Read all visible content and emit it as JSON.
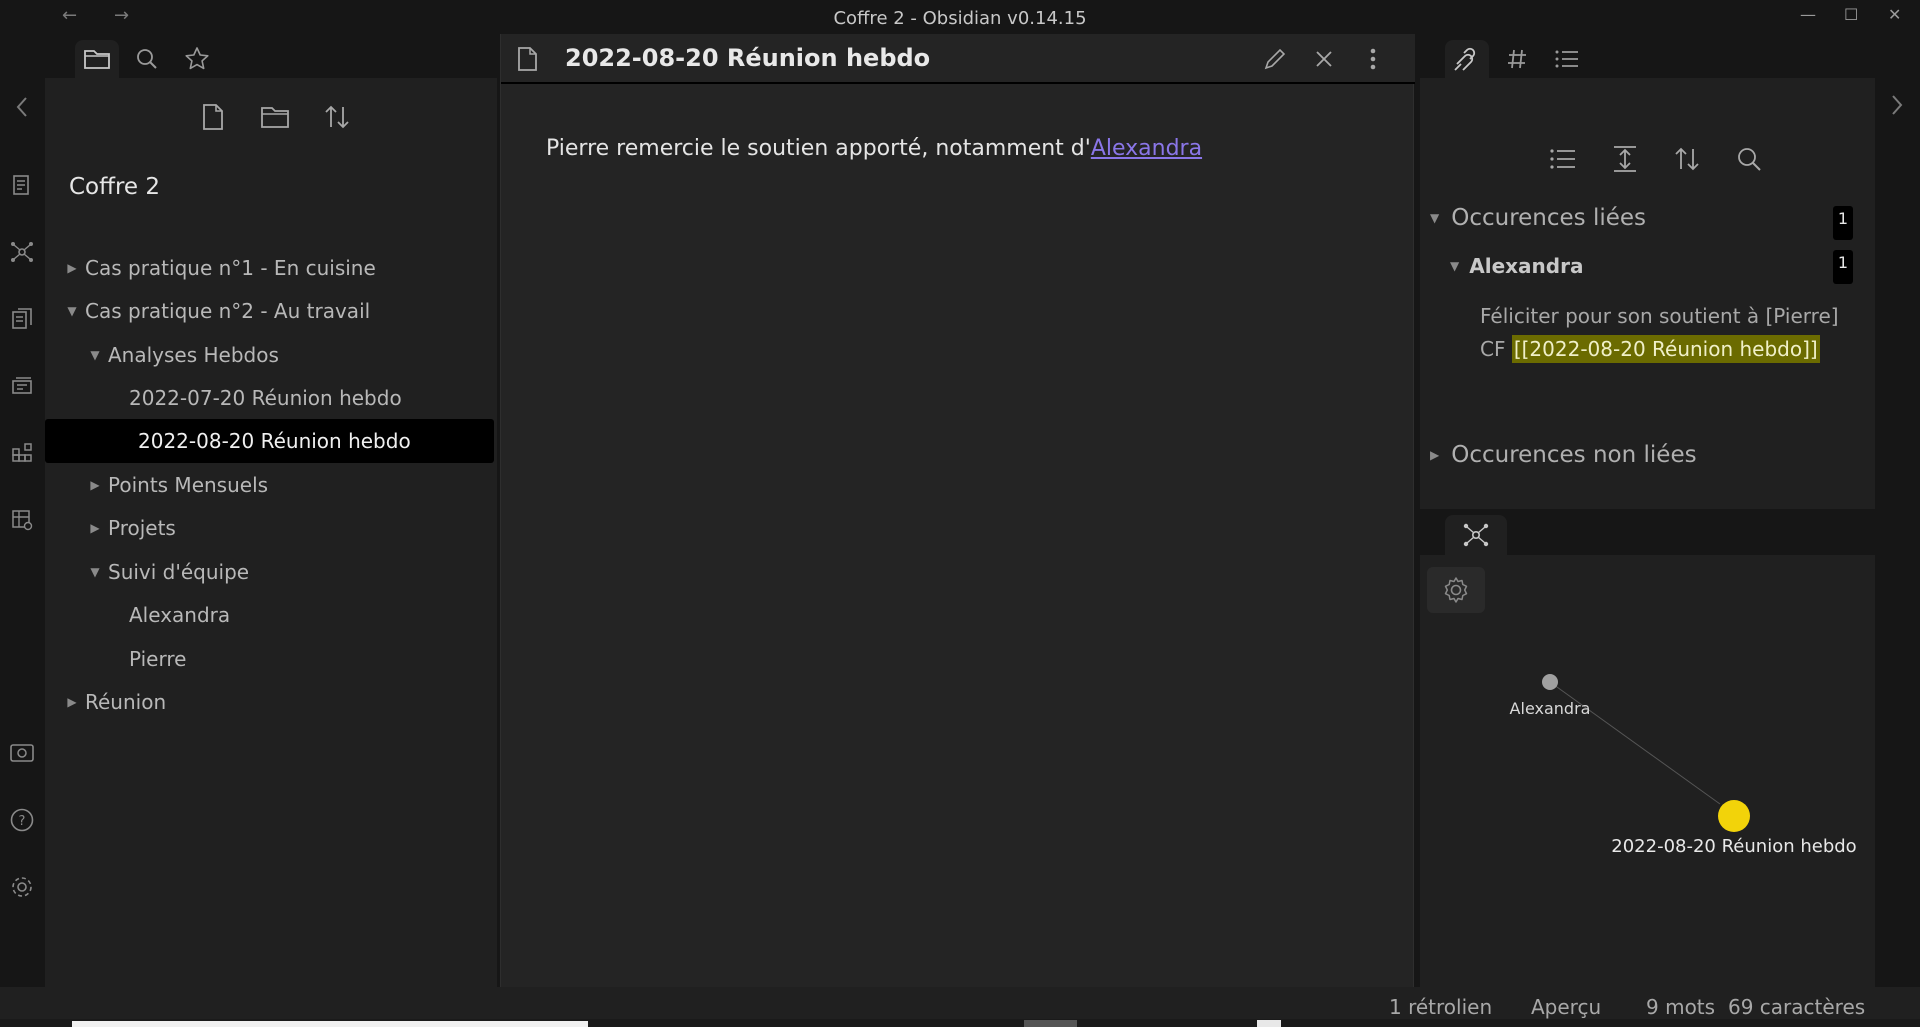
{
  "window": {
    "title": "Coffre 2 - Obsidian v0.14.15",
    "back": "←",
    "forward": "→",
    "minimize": "—",
    "maximize": "☐",
    "close": "✕"
  },
  "explorer": {
    "vault_name": "Coffre 2",
    "tree": [
      {
        "label": "Cas pratique n°1 - En cuisine",
        "caret": "▶"
      },
      {
        "label": "Cas pratique n°2 - Au travail",
        "caret": "▼"
      },
      {
        "label": "Analyses Hebdos",
        "caret": "▼"
      },
      {
        "label": "2022-07-20 Réunion hebdo",
        "caret": ""
      },
      {
        "label": "2022-08-20 Réunion hebdo",
        "caret": ""
      },
      {
        "label": "Points Mensuels",
        "caret": "▶"
      },
      {
        "label": "Projets",
        "caret": "▶"
      },
      {
        "label": "Suivi d'équipe",
        "caret": "▼"
      },
      {
        "label": "Alexandra",
        "caret": ""
      },
      {
        "label": "Pierre",
        "caret": ""
      },
      {
        "label": "Réunion",
        "caret": "▶"
      }
    ]
  },
  "editor": {
    "title": "2022-08-20 Réunion hebdo",
    "text_before": "Pierre remercie le soutien apporté, notamment d'",
    "link_text": "Alexandra"
  },
  "backlinks": {
    "linked_header": "Occurences liées",
    "linked_count": "1",
    "file_name": "Alexandra",
    "file_count": "1",
    "snippet_prefix": "Féliciter pour son soutient à [Pierre] CF ",
    "snippet_highlight": "[[2022-08-20 Réunion hebdo]]",
    "unlinked_header": "Occurences non liées",
    "caret_open": "▼",
    "caret_closed": "▶"
  },
  "graph": {
    "nodes": [
      {
        "label": "Alexandra",
        "color": "#a0a0a0"
      },
      {
        "label": "2022-08-20 Réunion hebdo",
        "color": "#f2d30a"
      }
    ]
  },
  "status": {
    "backlinks": "1 rétrolien",
    "mode": "Aperçu",
    "words": "9 mots",
    "chars": "69 caractères"
  },
  "colors": {
    "accent": "#8a76e8",
    "active_node": "#f2d30a",
    "highlight": "#6b6b00"
  }
}
